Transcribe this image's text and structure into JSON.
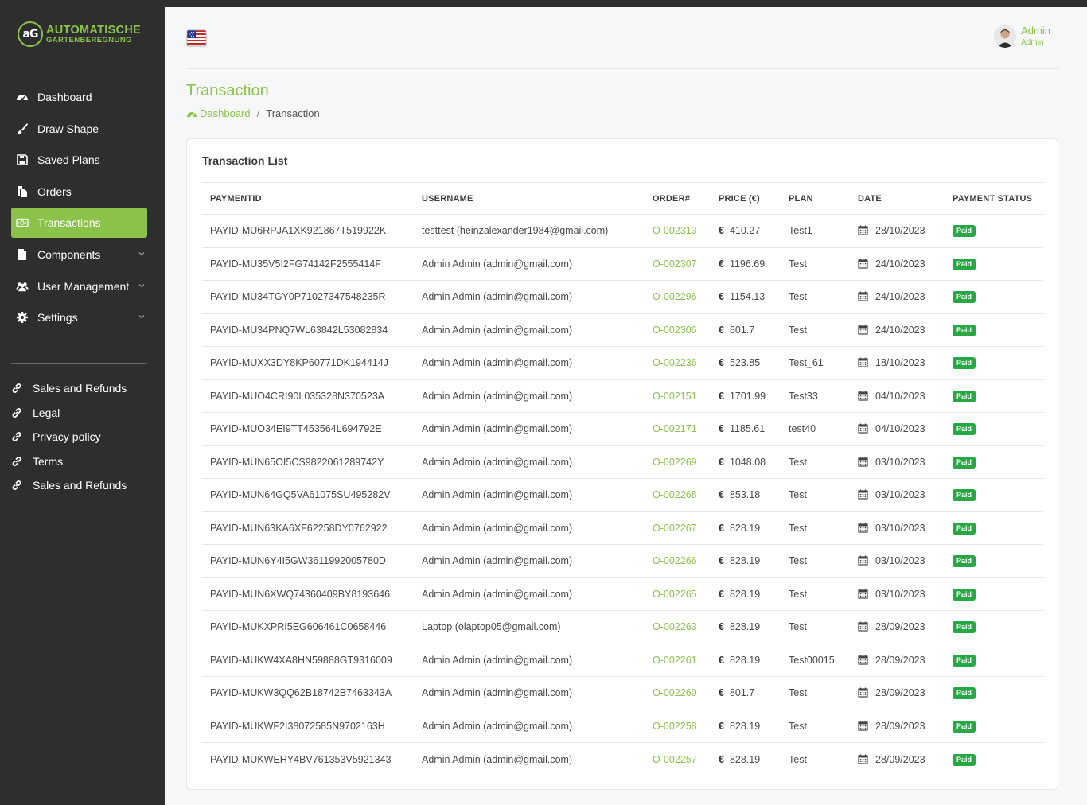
{
  "brand": {
    "mark": "aG",
    "line1": "AUTOMATISCHE",
    "line2": "GARTENBEREGNUNG",
    "accent": "#8bc34a"
  },
  "sidebar": {
    "items": [
      {
        "label": "Dashboard",
        "icon": "dashboard-icon",
        "active": false,
        "caret": false
      },
      {
        "label": "Draw Shape",
        "icon": "brush-icon",
        "active": false,
        "caret": false
      },
      {
        "label": "Saved Plans",
        "icon": "save-icon",
        "active": false,
        "caret": false
      },
      {
        "label": "Orders",
        "icon": "files-icon",
        "active": false,
        "caret": false
      },
      {
        "label": "Transactions",
        "icon": "money-icon",
        "active": true,
        "caret": false
      },
      {
        "label": "Components",
        "icon": "file-icon",
        "active": false,
        "caret": true
      },
      {
        "label": "User Management",
        "icon": "users-icon",
        "active": false,
        "caret": true
      },
      {
        "label": "Settings",
        "icon": "gear-icon",
        "active": false,
        "caret": true
      }
    ],
    "links": [
      "Sales and Refunds",
      "Legal",
      "Privacy policy",
      "Terms",
      "Sales and Refunds"
    ]
  },
  "header": {
    "user_name": "Admin",
    "user_role": "Admin",
    "flag": "us-flag-icon"
  },
  "page": {
    "title": "Transaction",
    "breadcrumb_home": "Dashboard",
    "breadcrumb_sep": "/",
    "breadcrumb_current": "Transaction"
  },
  "card": {
    "title": "Transaction List"
  },
  "table": {
    "columns": [
      "PAYMENTID",
      "USERNAME",
      "ORDER#",
      "PRICE (€)",
      "PLAN",
      "DATE",
      "PAYMENT STATUS"
    ],
    "currency_symbol": "€",
    "rows": [
      {
        "paymentid": "PAYID-MU6RPJA1XK921867T519922K",
        "username": "testtest (heinzalexander1984@gmail.com)",
        "order": "O-002313",
        "price": "410.27",
        "plan": "Test1",
        "date": "28/10/2023",
        "status": "Paid"
      },
      {
        "paymentid": "PAYID-MU35V5I2FG74142F2555414F",
        "username": "Admin Admin (admin@gmail.com)",
        "order": "O-002307",
        "price": "1196.69",
        "plan": "Test",
        "date": "24/10/2023",
        "status": "Paid"
      },
      {
        "paymentid": "PAYID-MU34TGY0P71027347548235R",
        "username": "Admin Admin (admin@gmail.com)",
        "order": "O-002296",
        "price": "1154.13",
        "plan": "Test",
        "date": "24/10/2023",
        "status": "Paid"
      },
      {
        "paymentid": "PAYID-MU34PNQ7WL63842L53082834",
        "username": "Admin Admin (admin@gmail.com)",
        "order": "O-002306",
        "price": "801.7",
        "plan": "Test",
        "date": "24/10/2023",
        "status": "Paid"
      },
      {
        "paymentid": "PAYID-MUXX3DY8KP60771DK194414J",
        "username": "Admin Admin (admin@gmail.com)",
        "order": "O-002236",
        "price": "523.85",
        "plan": "Test_61",
        "date": "18/10/2023",
        "status": "Paid"
      },
      {
        "paymentid": "PAYID-MUO4CRI90L035328N370523A",
        "username": "Admin Admin (admin@gmail.com)",
        "order": "O-002151",
        "price": "1701.99",
        "plan": "Test33",
        "date": "04/10/2023",
        "status": "Paid"
      },
      {
        "paymentid": "PAYID-MUO34EI9TT453564L694792E",
        "username": "Admin Admin (admin@gmail.com)",
        "order": "O-002171",
        "price": "1185.61",
        "plan": "test40",
        "date": "04/10/2023",
        "status": "Paid"
      },
      {
        "paymentid": "PAYID-MUN65OI5CS9822061289742Y",
        "username": "Admin Admin (admin@gmail.com)",
        "order": "O-002269",
        "price": "1048.08",
        "plan": "Test",
        "date": "03/10/2023",
        "status": "Paid"
      },
      {
        "paymentid": "PAYID-MUN64GQ5VA61075SU495282V",
        "username": "Admin Admin (admin@gmail.com)",
        "order": "O-002268",
        "price": "853.18",
        "plan": "Test",
        "date": "03/10/2023",
        "status": "Paid"
      },
      {
        "paymentid": "PAYID-MUN63KA6XF62258DY0762922",
        "username": "Admin Admin (admin@gmail.com)",
        "order": "O-002267",
        "price": "828.19",
        "plan": "Test",
        "date": "03/10/2023",
        "status": "Paid"
      },
      {
        "paymentid": "PAYID-MUN6Y4I5GW3611992005780D",
        "username": "Admin Admin (admin@gmail.com)",
        "order": "O-002266",
        "price": "828.19",
        "plan": "Test",
        "date": "03/10/2023",
        "status": "Paid"
      },
      {
        "paymentid": "PAYID-MUN6XWQ74360409BY8193646",
        "username": "Admin Admin (admin@gmail.com)",
        "order": "O-002265",
        "price": "828.19",
        "plan": "Test",
        "date": "03/10/2023",
        "status": "Paid"
      },
      {
        "paymentid": "PAYID-MUKXPRI5EG606461C0658446",
        "username": "Laptop (olaptop05@gmail.com)",
        "order": "O-002263",
        "price": "828.19",
        "plan": "Test",
        "date": "28/09/2023",
        "status": "Paid"
      },
      {
        "paymentid": "PAYID-MUKW4XA8HN59888GT9316009",
        "username": "Admin Admin (admin@gmail.com)",
        "order": "O-002261",
        "price": "828.19",
        "plan": "Test00015",
        "date": "28/09/2023",
        "status": "Paid"
      },
      {
        "paymentid": "PAYID-MUKW3QQ62B18742B7463343A",
        "username": "Admin Admin (admin@gmail.com)",
        "order": "O-002260",
        "price": "801.7",
        "plan": "Test",
        "date": "28/09/2023",
        "status": "Paid"
      },
      {
        "paymentid": "PAYID-MUKWF2I38072585N9702163H",
        "username": "Admin Admin (admin@gmail.com)",
        "order": "O-002258",
        "price": "828.19",
        "plan": "Test",
        "date": "28/09/2023",
        "status": "Paid"
      },
      {
        "paymentid": "PAYID-MUKWEHY4BV761353V5921343",
        "username": "Admin Admin (admin@gmail.com)",
        "order": "O-002257",
        "price": "828.19",
        "plan": "Test",
        "date": "28/09/2023",
        "status": "Paid"
      }
    ]
  },
  "colors": {
    "sidebar_bg": "#2e2e2e",
    "accent": "#8bc34a",
    "paid_badge": "#28a745"
  }
}
